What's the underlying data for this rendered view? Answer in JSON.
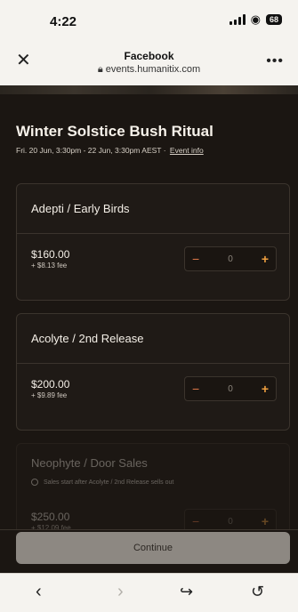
{
  "status_bar": {
    "time": "4:22",
    "battery": "68"
  },
  "browser": {
    "title": "Facebook",
    "url": "events.humanitix.com",
    "close_icon": "close-icon",
    "more_icon": "more-icon"
  },
  "event": {
    "title": "Winter Solstice Bush Ritual",
    "subtitle": "Fri. 20 Jun, 3:30pm - 22 Jun, 3:30pm AEST",
    "event_info_link": "Event info"
  },
  "tickets": [
    {
      "name": "Adepti / Early Birds",
      "price": "$160.00",
      "fee": "+ $8.13 fee",
      "quantity": "0",
      "disabled": false
    },
    {
      "name": "Acolyte / 2nd Release",
      "price": "$200.00",
      "fee": "+ $9.89 fee",
      "quantity": "0",
      "disabled": false
    },
    {
      "name": "Neophyte / Door Sales",
      "note": "Sales start after Acolyte / 2nd Release sells out",
      "price": "$250.00",
      "fee": "+ $12.09 fee",
      "quantity": "0",
      "disabled": true
    }
  ],
  "footer": {
    "continue_label": "Continue"
  },
  "toolbar": {
    "back_icon": "chevron-left-icon",
    "forward_icon": "chevron-right-icon",
    "share_icon": "share-icon",
    "history_icon": "history-icon"
  },
  "colors": {
    "dark_bg": "#1b1612",
    "accent_orange": "#f0a040",
    "button_gray": "#8d8882"
  }
}
